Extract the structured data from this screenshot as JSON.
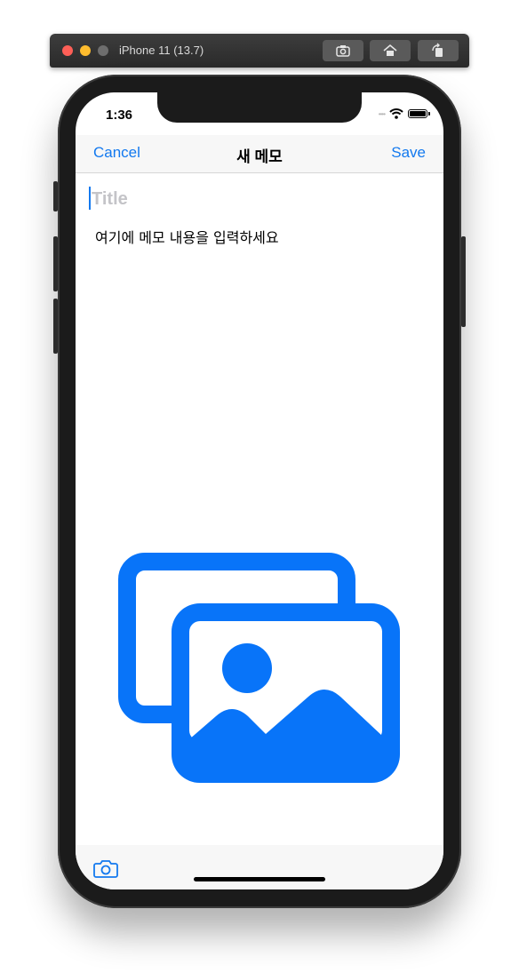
{
  "simulator": {
    "window_title": "iPhone 11 (13.7)",
    "buttons": [
      "screenshot-icon",
      "home-icon",
      "rotate-icon"
    ]
  },
  "status_bar": {
    "time": "1:36",
    "signal": "••••"
  },
  "navbar": {
    "cancel_label": "Cancel",
    "title": "새 메모",
    "save_label": "Save"
  },
  "editor": {
    "title_placeholder": "Title",
    "body_placeholder": "여기에 메모 내용을 입력하세요"
  },
  "toolbar": {
    "camera_icon": "camera-icon"
  },
  "colors": {
    "accent": "#1379ef",
    "photo_icon": "#0874f9"
  }
}
